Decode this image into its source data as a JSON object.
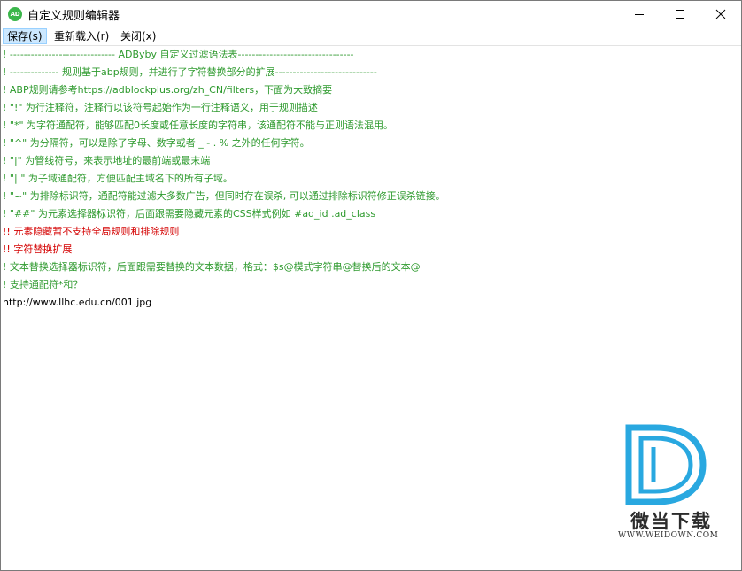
{
  "window": {
    "title": "自定义规则编辑器",
    "icon_label": "AD",
    "minimize_icon": "minimize-icon",
    "maximize_icon": "maximize-icon",
    "close_icon": "close-icon"
  },
  "menu": {
    "items": [
      {
        "label": "保存(s)"
      },
      {
        "label": "重新载入(r)"
      },
      {
        "label": "关闭(x)"
      }
    ]
  },
  "editor": {
    "lines": [
      {
        "text": "! ------------------------------ ADByby 自定义过滤语法表---------------------------------",
        "color": "#2e9a2e"
      },
      {
        "text": "! --------------  规则基于abp规则，并进行了字符替换部分的扩展-----------------------------",
        "color": "#2e9a2e"
      },
      {
        "text": "! ABP规则请参考https://adblockplus.org/zh_CN/filters，下面为大致摘要",
        "color": "#2e9a2e"
      },
      {
        "text": "! \"!\" 为行注释符，注释行以该符号起始作为一行注释语义，用于规则描述",
        "color": "#2e9a2e"
      },
      {
        "text": "! \"*\" 为字符通配符，能够匹配0长度或任意长度的字符串，该通配符不能与正则语法混用。",
        "color": "#2e9a2e"
      },
      {
        "text": "! \"^\" 为分隔符，可以是除了字母、数字或者 _ - . % 之外的任何字符。",
        "color": "#2e9a2e"
      },
      {
        "text": "! \"|\" 为管线符号，来表示地址的最前端或最末端",
        "color": "#2e9a2e"
      },
      {
        "text": "! \"||\" 为子域通配符，方便匹配主域名下的所有子域。",
        "color": "#2e9a2e"
      },
      {
        "text": "! \"~\" 为排除标识符，通配符能过滤大多数广告，但同时存在误杀, 可以通过排除标识符修正误杀链接。",
        "color": "#2e9a2e"
      },
      {
        "text": "! \"##\" 为元素选择器标识符，后面跟需要隐藏元素的CSS样式例如 #ad_id  .ad_class",
        "color": "#2e9a2e"
      },
      {
        "text": "!! 元素隐藏暂不支持全局规则和排除规则",
        "color": "#d40000"
      },
      {
        "text": "!! 字符替换扩展",
        "color": "#d40000"
      },
      {
        "text": "! 文本替换选择器标识符，后面跟需要替换的文本数据，格式：$s@模式字符串@替换后的文本@",
        "color": "#2e9a2e"
      },
      {
        "text": "! 支持通配符*和？",
        "color": "#2e9a2e"
      },
      {
        "text": "http://www.llhc.edu.cn/001.jpg",
        "color": "#000000"
      }
    ]
  },
  "watermark": {
    "logo_icon": "weidown-d-logo",
    "name": "微当下载",
    "url": "WWW.WEIDOWN.COM",
    "color": "#29a8e0"
  }
}
